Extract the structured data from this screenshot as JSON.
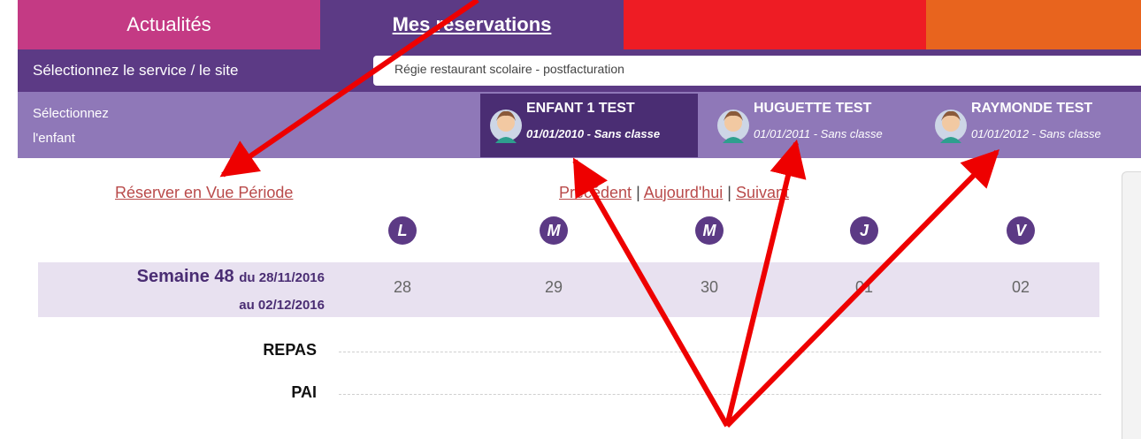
{
  "nav": {
    "tabs": [
      {
        "label": "Actualités"
      },
      {
        "label": "Mes réservations"
      },
      {
        "label": ""
      },
      {
        "label": ""
      }
    ]
  },
  "service": {
    "label": "Sélectionnez le service / le site",
    "value": "Régie restaurant scolaire - postfacturation"
  },
  "child_select": {
    "label_line1": "Sélectionnez",
    "label_line2": "l'enfant",
    "children": [
      {
        "name": "ENFANT 1 TEST",
        "info": "01/01/2010 - Sans classe",
        "active": true
      },
      {
        "name": "HUGUETTE TEST",
        "info": "01/01/2011 - Sans classe",
        "active": false
      },
      {
        "name": "RAYMONDE TEST",
        "info": "01/01/2012 - Sans classe",
        "active": false
      }
    ]
  },
  "calendar": {
    "reserve_link": "Réserver en Vue Période",
    "prev": "Précédent",
    "today": "Aujourd'hui",
    "next": "Suivant",
    "separator": "|",
    "days": [
      "L",
      "M",
      "M",
      "J",
      "V"
    ],
    "week_label": "Semaine 48",
    "week_from": "du 28/11/2016",
    "week_to": "au 02/12/2016",
    "dates": [
      "28",
      "29",
      "30",
      "01",
      "02"
    ],
    "rows": [
      "REPAS",
      "PAI"
    ]
  },
  "colors": {
    "purple_dark": "#5c3a85",
    "purple_light": "#8f78b8",
    "pink": "#c43a84",
    "red": "#ee1c24",
    "orange": "#e8641e",
    "annotation_arrow": "#ee0000"
  }
}
